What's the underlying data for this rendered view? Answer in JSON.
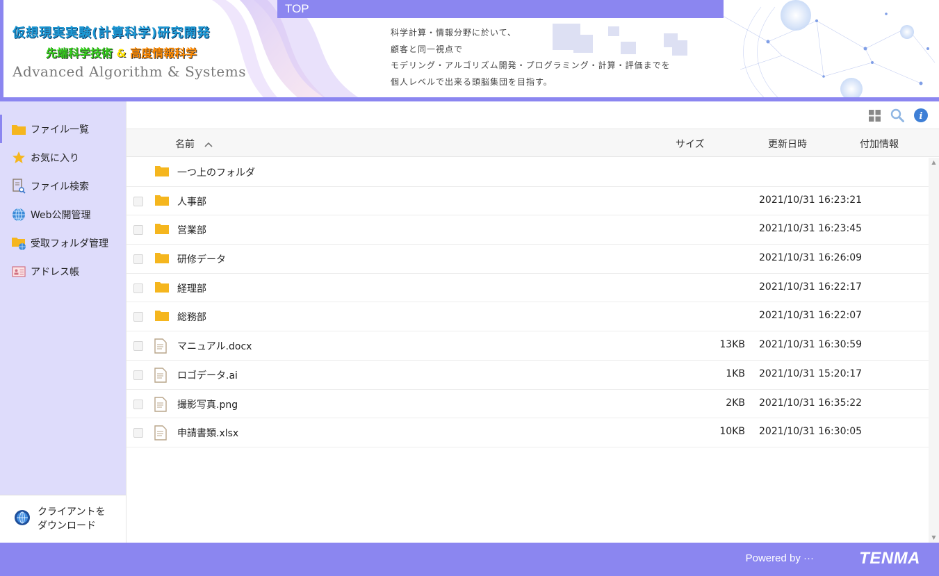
{
  "header": {
    "logo_line1": "仮想現実実験(計算科学)研究開発",
    "logo_line2_a": "先端科学技術",
    "logo_line2_amp": "&",
    "logo_line2_b": "高度情報科学",
    "logo_line3": "Advanced Algorithm & Systems",
    "top_tab": "TOP",
    "tagline": [
      "科学計算・情報分野に於いて、",
      "顧客と同一視点で",
      "モデリング・アルゴリズム開発・プログラミング・計算・評価までを",
      "個人レベルで出来る頭脳集団を目指す。"
    ]
  },
  "sidebar": {
    "items": [
      {
        "label": "ファイル一覧",
        "icon": "folder-icon"
      },
      {
        "label": "お気に入り",
        "icon": "star-icon"
      },
      {
        "label": "ファイル検索",
        "icon": "file-search-icon"
      },
      {
        "label": "Web公開管理",
        "icon": "globe-icon"
      },
      {
        "label": "受取フォルダ管理",
        "icon": "folder-globe-icon"
      },
      {
        "label": "アドレス帳",
        "icon": "address-card-icon"
      }
    ],
    "download_line1": "クライアントを",
    "download_line2": "ダウンロード"
  },
  "table": {
    "col_name": "名前",
    "col_size": "サイズ",
    "col_date": "更新日時",
    "col_info": "付加情報",
    "parent_folder": "一つ上のフォルダ",
    "rows": [
      {
        "name": "人事部",
        "type": "folder",
        "size": "",
        "date": "2021/10/31 16:23:21"
      },
      {
        "name": "営業部",
        "type": "folder",
        "size": "",
        "date": "2021/10/31 16:23:45"
      },
      {
        "name": "研修データ",
        "type": "folder",
        "size": "",
        "date": "2021/10/31 16:26:09"
      },
      {
        "name": "経理部",
        "type": "folder",
        "size": "",
        "date": "2021/10/31 16:22:17"
      },
      {
        "name": "総務部",
        "type": "folder",
        "size": "",
        "date": "2021/10/31 16:22:07"
      },
      {
        "name": "マニュアル.docx",
        "type": "file",
        "size": "13KB",
        "date": "2021/10/31 16:30:59"
      },
      {
        "name": "ロゴデータ.ai",
        "type": "file",
        "size": "1KB",
        "date": "2021/10/31 15:20:17"
      },
      {
        "name": "撮影写真.png",
        "type": "file",
        "size": "2KB",
        "date": "2021/10/31 16:35:22"
      },
      {
        "name": "申請書類.xlsx",
        "type": "file",
        "size": "10KB",
        "date": "2021/10/31 16:30:05"
      }
    ]
  },
  "footer": {
    "powered": "Powered by ···",
    "brand": "TENMA"
  },
  "colors": {
    "accent": "#8b86f0",
    "sidebar_bg": "#dedcfb",
    "folder": "#f5b61e",
    "file_icon": "#b9a58a"
  }
}
